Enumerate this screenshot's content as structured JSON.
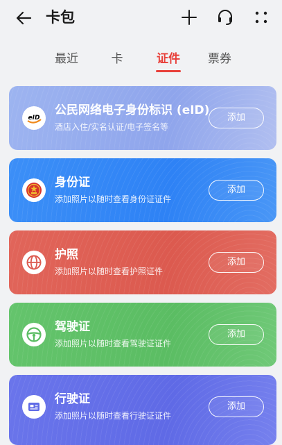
{
  "header": {
    "title": "卡包",
    "back_icon": "arrow-left-icon",
    "add_icon": "plus-icon",
    "service_icon": "headset-icon",
    "more_icon": "more-dots-icon"
  },
  "tabs": [
    {
      "label": "最近",
      "active": false
    },
    {
      "label": "卡",
      "active": false
    },
    {
      "label": "证件",
      "active": true
    },
    {
      "label": "票券",
      "active": false
    }
  ],
  "cards": [
    {
      "title": "公民网络电子身份标识 (eID)",
      "subtitle": "酒店入住/实名认证/电子签名等",
      "button": "添加",
      "icon": "eid-icon",
      "icon_text": "eID",
      "color": "#95aced"
    },
    {
      "title": "身份证",
      "subtitle": "添加照片以随时查看身份证证件",
      "button": "添加",
      "icon": "national-emblem-icon",
      "color": "#3488f6"
    },
    {
      "title": "护照",
      "subtitle": "添加照片以随时查看护照证件",
      "button": "添加",
      "icon": "globe-icon",
      "color": "#de5f54"
    },
    {
      "title": "驾驶证",
      "subtitle": "添加照片以随时查看驾驶证证件",
      "button": "添加",
      "icon": "steering-wheel-icon",
      "color": "#5fc067"
    },
    {
      "title": "行驶证",
      "subtitle": "添加照片以随时查看行驶证证件",
      "button": "添加",
      "icon": "vehicle-license-icon",
      "color": "#646fe8"
    }
  ],
  "colors": {
    "accent": "#e8403a",
    "background": "#f1f2f4"
  }
}
